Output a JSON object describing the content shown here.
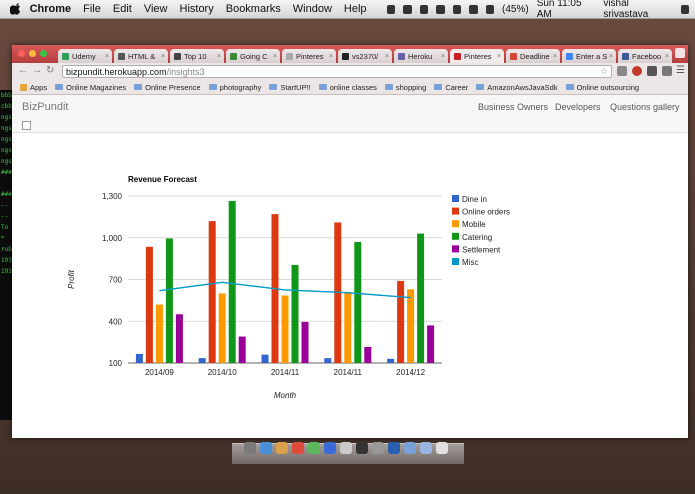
{
  "menubar": {
    "app": "Chrome",
    "items": [
      "File",
      "Edit",
      "View",
      "History",
      "Bookmarks",
      "Window",
      "Help"
    ],
    "battery": "(45%)",
    "clock": "Sun 11:05 AM",
    "user": "vishal srivastava"
  },
  "tabs": [
    {
      "label": "Udemy",
      "color": "#2e9e5a"
    },
    {
      "label": "HTML &",
      "color": "#555555"
    },
    {
      "label": "Top 10",
      "color": "#444444"
    },
    {
      "label": "Going C",
      "color": "#3a8a3a"
    },
    {
      "label": "Pinteres",
      "color": "#aaaaaa"
    },
    {
      "label": "vs2370/",
      "color": "#222222"
    },
    {
      "label": "Heroku",
      "color": "#6762a6"
    },
    {
      "label": "Pinteres",
      "color": "#cb2027",
      "active": true
    },
    {
      "label": "Deadline",
      "color": "#d44638"
    },
    {
      "label": "Enter a S",
      "color": "#4285f4"
    },
    {
      "label": "Faceboo",
      "color": "#3b5998"
    }
  ],
  "address": {
    "host": "bizpundit.herokuapp.com",
    "path": "/insights3"
  },
  "bookmarks": [
    "Apps",
    "Online Magazines",
    "Online Presence",
    "photography",
    "StartUP!!",
    "online classes",
    "shopping",
    "Career",
    "AmazonAwsJavaSdk",
    "Online outsourcing"
  ],
  "site": {
    "brand": "BizPundit",
    "nav": [
      "Business Owners",
      "Developers",
      "Questions gallery"
    ]
  },
  "terminal": [
    "bbb",
    "cbb",
    "ngs",
    "ngs",
    "ngs",
    "ngs",
    "ngs",
    "###",
    "",
    "###",
    "--",
    "--",
    "To",
    " *",
    "rub",
    "193",
    "193"
  ],
  "chart_data": {
    "type": "bar",
    "title": "Revenue Forecast",
    "xlabel": "Month",
    "ylabel": "Profit",
    "ylim": [
      100,
      1300
    ],
    "yticks": [
      "1,300",
      "1,000",
      "700",
      "400",
      "100"
    ],
    "ytick_values": [
      1300,
      1000,
      700,
      400,
      100
    ],
    "grid": true,
    "legend_position": "right",
    "categories": [
      "2014/09",
      "2014/10",
      "2014/11",
      "2014/11",
      "2014/12"
    ],
    "series": [
      {
        "name": "Dine in",
        "color": "#3366cc",
        "type": "bar",
        "values": [
          165,
          135,
          160,
          135,
          130
        ]
      },
      {
        "name": "Online orders",
        "color": "#dc3912",
        "type": "bar",
        "values": [
          935,
          1120,
          1170,
          1110,
          690
        ]
      },
      {
        "name": "Mobile",
        "color": "#ff9900",
        "type": "bar",
        "values": [
          520,
          600,
          585,
          610,
          630
        ]
      },
      {
        "name": "Catering",
        "color": "#109618",
        "type": "bar",
        "values": [
          995,
          1265,
          805,
          970,
          1030
        ]
      },
      {
        "name": "Settlement",
        "color": "#990099",
        "type": "bar",
        "values": [
          450,
          290,
          395,
          215,
          370
        ]
      },
      {
        "name": "Misc",
        "color": "#0099c6",
        "type": "line",
        "values": [
          620,
          680,
          625,
          605,
          570
        ]
      }
    ]
  }
}
